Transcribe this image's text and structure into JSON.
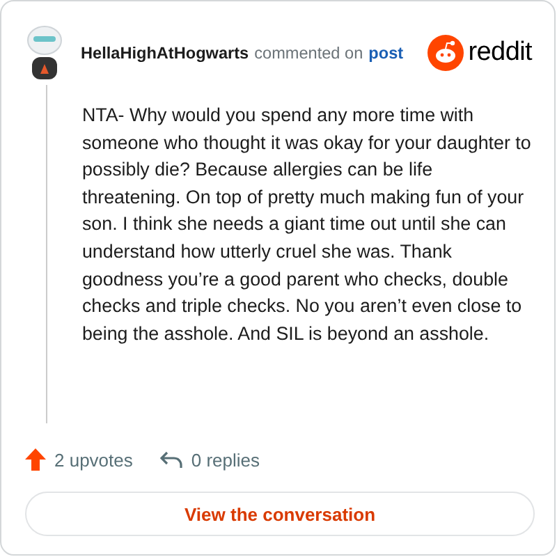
{
  "header": {
    "username": "HellaHighAtHogwarts",
    "action": "commented on",
    "link": "post",
    "brand": "reddit"
  },
  "comment": {
    "text": "NTA- Why would you spend any more time with someone who thought it was okay for your daughter to possibly die? Because allergies can be life threatening. On top of pretty much making fun of your son. I think she needs a giant time out until she can understand how utterly cruel she was. Thank goodness you’re a good parent who checks, double checks and triple checks. No you aren’t even close to being the asshole. And SIL is beyond an asshole."
  },
  "stats": {
    "upvotes": "2 upvotes",
    "replies": "0 replies"
  },
  "button": "View the conversation"
}
